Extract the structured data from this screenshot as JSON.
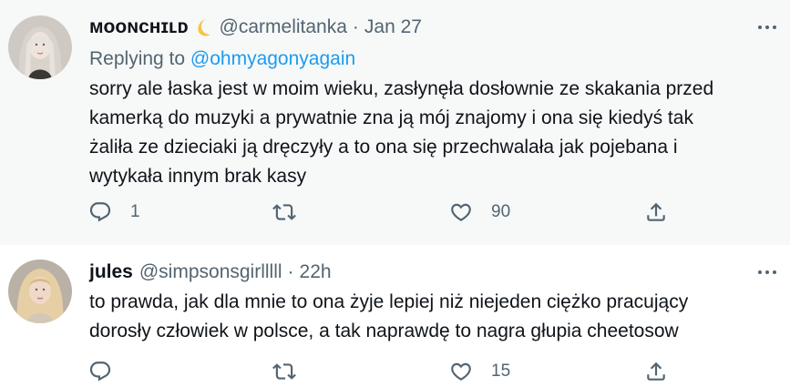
{
  "tweets": [
    {
      "display_name": "ᴍᴏᴏɴᴄʜɪʟᴅ",
      "name_emoji": "crescent-moon-icon",
      "handle": "@carmelitanka",
      "separator": "·",
      "time": "Jan 27",
      "replying_prefix": "Replying to",
      "replying_to": "@ohmyagonyagain",
      "text_lines": [
        "sorry ale łaska jest w moim wieku, zasłynęła dosłownie ze skakania przed",
        "kamerką do muzyki a prywatnie zna ją mój znajomy i ona się kiedyś tak",
        "żaliła ze dzieciaki ją dręczyły a to ona się przechwalała jak pojebana i",
        "wytykała innym brak kasy"
      ],
      "reply_count": "1",
      "retweet_count": "",
      "like_count": "90"
    },
    {
      "display_name": "jules",
      "handle": "@simpsonsgirlllll",
      "separator": "·",
      "time": "22h",
      "text_lines": [
        "to prawda, jak dla mnie to ona żyje lepiej niż niejeden ciężko pracujący",
        "dorosły człowiek w polsce, a tak naprawdę to nagra głupia cheetosow"
      ],
      "reply_count": "",
      "retweet_count": "",
      "like_count": "15"
    }
  ],
  "colors": {
    "primary_text": "#0f1419",
    "secondary_text": "#536471",
    "link": "#1d9bf0",
    "highlight_bg": "#f7f9f9",
    "thread_line": "#cfd9de"
  },
  "icons": [
    "reply-icon",
    "retweet-icon",
    "like-icon",
    "share-icon",
    "more-icon"
  ]
}
